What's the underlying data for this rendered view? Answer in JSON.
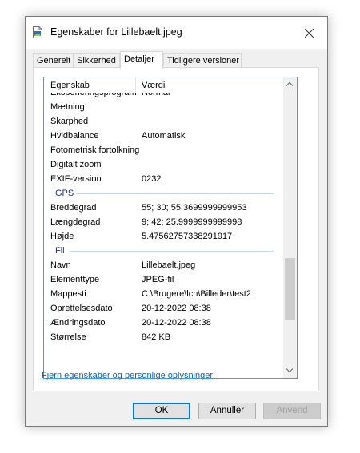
{
  "window": {
    "title": "Egenskaber for Lillebaelt.jpeg",
    "icon": "jpeg-file-icon",
    "close_icon": "close-icon"
  },
  "tabs": [
    {
      "label": "Generelt",
      "active": false
    },
    {
      "label": "Sikkerhed",
      "active": false
    },
    {
      "label": "Detaljer",
      "active": true
    },
    {
      "label": "Tidligere versioner",
      "active": false
    }
  ],
  "details": {
    "col_property": "Egenskab",
    "col_value": "Værdi",
    "partial_row": {
      "key": "Eksponeringsprogram",
      "value": "Normal"
    },
    "rows_a": [
      {
        "key": "Mætning",
        "value": ""
      },
      {
        "key": "Skarphed",
        "value": ""
      },
      {
        "key": "Hvidbalance",
        "value": "Automatisk"
      },
      {
        "key": "Fotometrisk fortolkning",
        "value": ""
      },
      {
        "key": "Digitalt zoom",
        "value": ""
      },
      {
        "key": "EXIF-version",
        "value": "0232"
      }
    ],
    "group_gps": "GPS",
    "rows_gps": [
      {
        "key": "Breddegrad",
        "value": "55; 30; 55.3699999999953"
      },
      {
        "key": "Længdegrad",
        "value": "9; 42; 25.9999999999998"
      },
      {
        "key": "Højde",
        "value": "5.47562757338291917"
      }
    ],
    "group_file": "Fil",
    "rows_file": [
      {
        "key": "Navn",
        "value": "Lillebaelt.jpeg"
      },
      {
        "key": "Elementtype",
        "value": "JPEG-fil"
      },
      {
        "key": "Mappesti",
        "value": "C:\\Brugere\\lch\\Billeder\\test2"
      },
      {
        "key": "Oprettelsesdato",
        "value": "20-12-2022 08:38"
      },
      {
        "key": "Ændringsdato",
        "value": "20-12-2022 08:38"
      },
      {
        "key": "Størrelse",
        "value": "842 KB"
      }
    ]
  },
  "remove_link": "Fjern egenskaber og personlige oplysninger",
  "buttons": {
    "ok": "OK",
    "cancel": "Annuller",
    "apply": "Anvend",
    "apply_enabled": false
  },
  "colors": {
    "link": "#0066cc",
    "group_heading": "#1e3287",
    "focus_border": "#0078d7"
  }
}
